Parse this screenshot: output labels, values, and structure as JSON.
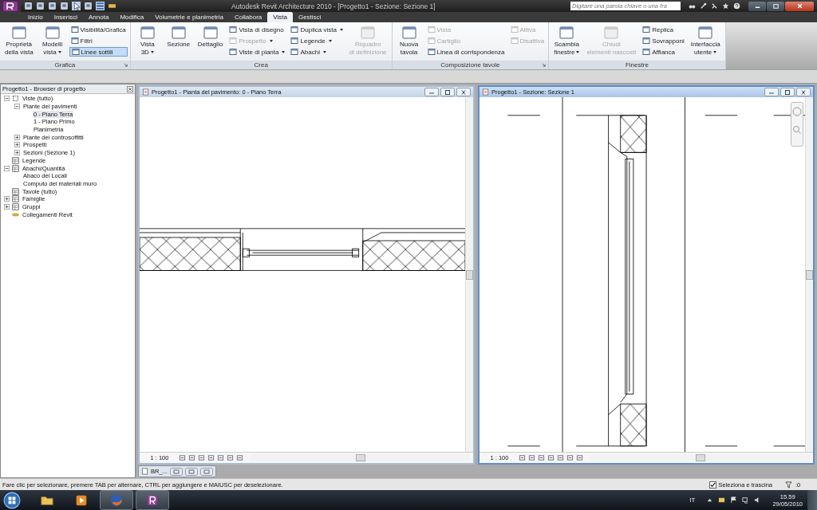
{
  "title_bar": {
    "title": "Autodesk Revit Architecture 2010 - [Progetto1 - Sezione: Sezione 1]",
    "search": {
      "placeholder": "Digitare una parola chiave o una fra"
    }
  },
  "ribbon": {
    "tabs": [
      {
        "label": "Inizio",
        "selected": false
      },
      {
        "label": "Inserisci",
        "selected": false
      },
      {
        "label": "Annota",
        "selected": false
      },
      {
        "label": "Modifica",
        "selected": false
      },
      {
        "label": "Volumetrie e planimetria",
        "selected": false
      },
      {
        "label": "Collabora",
        "selected": false
      },
      {
        "label": "Vista",
        "selected": true
      },
      {
        "label": "Gestisci",
        "selected": false
      }
    ],
    "panels": [
      {
        "title": "Grafica",
        "launcher": true,
        "groups": [
          {
            "kind": "large",
            "label": "Proprietà\ndella vista",
            "dropdown": false,
            "disabled": false
          },
          {
            "kind": "large",
            "label": "Modelli\nvista",
            "dropdown": true,
            "disabled": false
          },
          {
            "kind": "stack",
            "items": [
              {
                "label": "Visibilità/Grafica",
                "dropdown": false,
                "disabled": false,
                "selected": false
              },
              {
                "label": "Filtri",
                "dropdown": false,
                "disabled": false,
                "selected": false
              },
              {
                "label": "Linee sottili",
                "dropdown": false,
                "disabled": false,
                "selected": true
              }
            ]
          }
        ]
      },
      {
        "title": "Crea",
        "launcher": false,
        "groups": [
          {
            "kind": "large",
            "label": "Vista\n3D",
            "dropdown": true,
            "disabled": false
          },
          {
            "kind": "large",
            "label": "Sezione",
            "dropdown": false,
            "disabled": false
          },
          {
            "kind": "large",
            "label": "Dettaglio",
            "dropdown": false,
            "disabled": false
          },
          {
            "kind": "stack",
            "items": [
              {
                "label": "Vista di disegno",
                "dropdown": false,
                "disabled": false,
                "selected": false
              },
              {
                "label": "Prospetto",
                "dropdown": true,
                "disabled": true,
                "selected": false
              },
              {
                "label": "Viste di pianta",
                "dropdown": true,
                "disabled": false,
                "selected": false
              }
            ]
          },
          {
            "kind": "stack",
            "items": [
              {
                "label": "Duplica vista",
                "dropdown": true,
                "disabled": false,
                "selected": false
              },
              {
                "label": "Legende",
                "dropdown": true,
                "disabled": false,
                "selected": false
              },
              {
                "label": "Abachi",
                "dropdown": true,
                "disabled": false,
                "selected": false
              }
            ]
          },
          {
            "kind": "large",
            "label": "Riquadro\ndi definizione",
            "dropdown": false,
            "disabled": true
          }
        ]
      },
      {
        "title": "Composizione tavole",
        "launcher": true,
        "groups": [
          {
            "kind": "large",
            "label": "Nuova\ntavola",
            "dropdown": false,
            "disabled": false
          },
          {
            "kind": "stack",
            "items": [
              {
                "label": "Vista",
                "dropdown": false,
                "disabled": true,
                "selected": false
              },
              {
                "label": "Cartiglio",
                "dropdown": false,
                "disabled": true,
                "selected": false
              },
              {
                "label": "Linea di corrispondenza",
                "dropdown": false,
                "disabled": false,
                "selected": false
              }
            ]
          },
          {
            "kind": "stack",
            "items": [
              {
                "label": "Attiva",
                "dropdown": false,
                "disabled": true,
                "selected": false
              },
              {
                "label": "Disattiva",
                "dropdown": false,
                "disabled": true,
                "selected": false
              }
            ]
          }
        ]
      },
      {
        "title": "Finestre",
        "launcher": false,
        "groups": [
          {
            "kind": "large",
            "label": "Scambia\nfinestre",
            "dropdown": true,
            "disabled": false
          },
          {
            "kind": "large",
            "label": "Chiudi\nelementi nascosti",
            "dropdown": false,
            "disabled": true
          },
          {
            "kind": "stack",
            "items": [
              {
                "label": "Replica",
                "dropdown": false,
                "disabled": false,
                "selected": false
              },
              {
                "label": "Sovrapponi",
                "dropdown": false,
                "disabled": false,
                "selected": false
              },
              {
                "label": "Affianca",
                "dropdown": false,
                "disabled": false,
                "selected": false
              }
            ]
          },
          {
            "kind": "large",
            "label": "Interfaccia\nutente",
            "dropdown": true,
            "disabled": false
          }
        ]
      }
    ]
  },
  "browser": {
    "title": "Progetto1 - Browser di progetto",
    "tree": [
      {
        "label": "Viste (tutto)",
        "kind": "views",
        "expanded": true,
        "selected": false,
        "children": [
          {
            "label": "Piante dei pavimenti",
            "expanded": true,
            "selected": false,
            "children": [
              {
                "label": "0 - Piano Terra",
                "selected": true
              },
              {
                "label": "1 - Piano Primo",
                "selected": false
              },
              {
                "label": "Planimetria",
                "selected": false
              }
            ]
          },
          {
            "label": "Piante dei controsoffitti",
            "expanded": false,
            "selected": false
          },
          {
            "label": "Prospetti",
            "expanded": false,
            "selected": false
          },
          {
            "label": "Sezioni (Sezione 1)",
            "expanded": false,
            "selected": false
          }
        ]
      },
      {
        "label": "Legende",
        "kind": "legend",
        "selected": false
      },
      {
        "label": "Abachi/Quantità",
        "kind": "schedule",
        "expanded": true,
        "selected": false,
        "children": [
          {
            "label": "Abaco dei Locali",
            "selected": false
          },
          {
            "label": "Computo dei materiali muro",
            "selected": false
          }
        ]
      },
      {
        "label": "Tavole (tutto)",
        "kind": "sheet",
        "selected": false
      },
      {
        "label": "Famiglie",
        "kind": "family",
        "expanded": false,
        "selected": false
      },
      {
        "label": "Gruppi",
        "kind": "group",
        "expanded": false,
        "selected": false
      },
      {
        "label": "Collegamenti Revit",
        "kind": "link",
        "selected": false
      }
    ]
  },
  "windows": [
    {
      "title": "Progetto1 - Pianta del pavimento: 0 - Piano Terra",
      "kind": "plan",
      "active": false,
      "scale": "1 : 100"
    },
    {
      "title": "Progetto1 - Sezione: Sezione 1",
      "kind": "section",
      "active": true,
      "scale": "1 : 100"
    }
  ],
  "minimized_window": {
    "label": "BR_..."
  },
  "status_bar": {
    "message": "Fare clic per selezionare, premere TAB per alternare, CTRL per aggiungere e MAIUSC per deselezionare.",
    "drag_select": {
      "label": "Seleziona e trascina",
      "checked": true
    },
    "filter_count": ":0"
  },
  "taskbar": {
    "apps": [
      {
        "kind": "folder",
        "running": false
      },
      {
        "kind": "media",
        "running": false
      },
      {
        "kind": "browser",
        "running": true
      },
      {
        "kind": "revit",
        "running": true
      }
    ],
    "language": "IT",
    "time": "15.59",
    "date": "29/05/2010"
  }
}
